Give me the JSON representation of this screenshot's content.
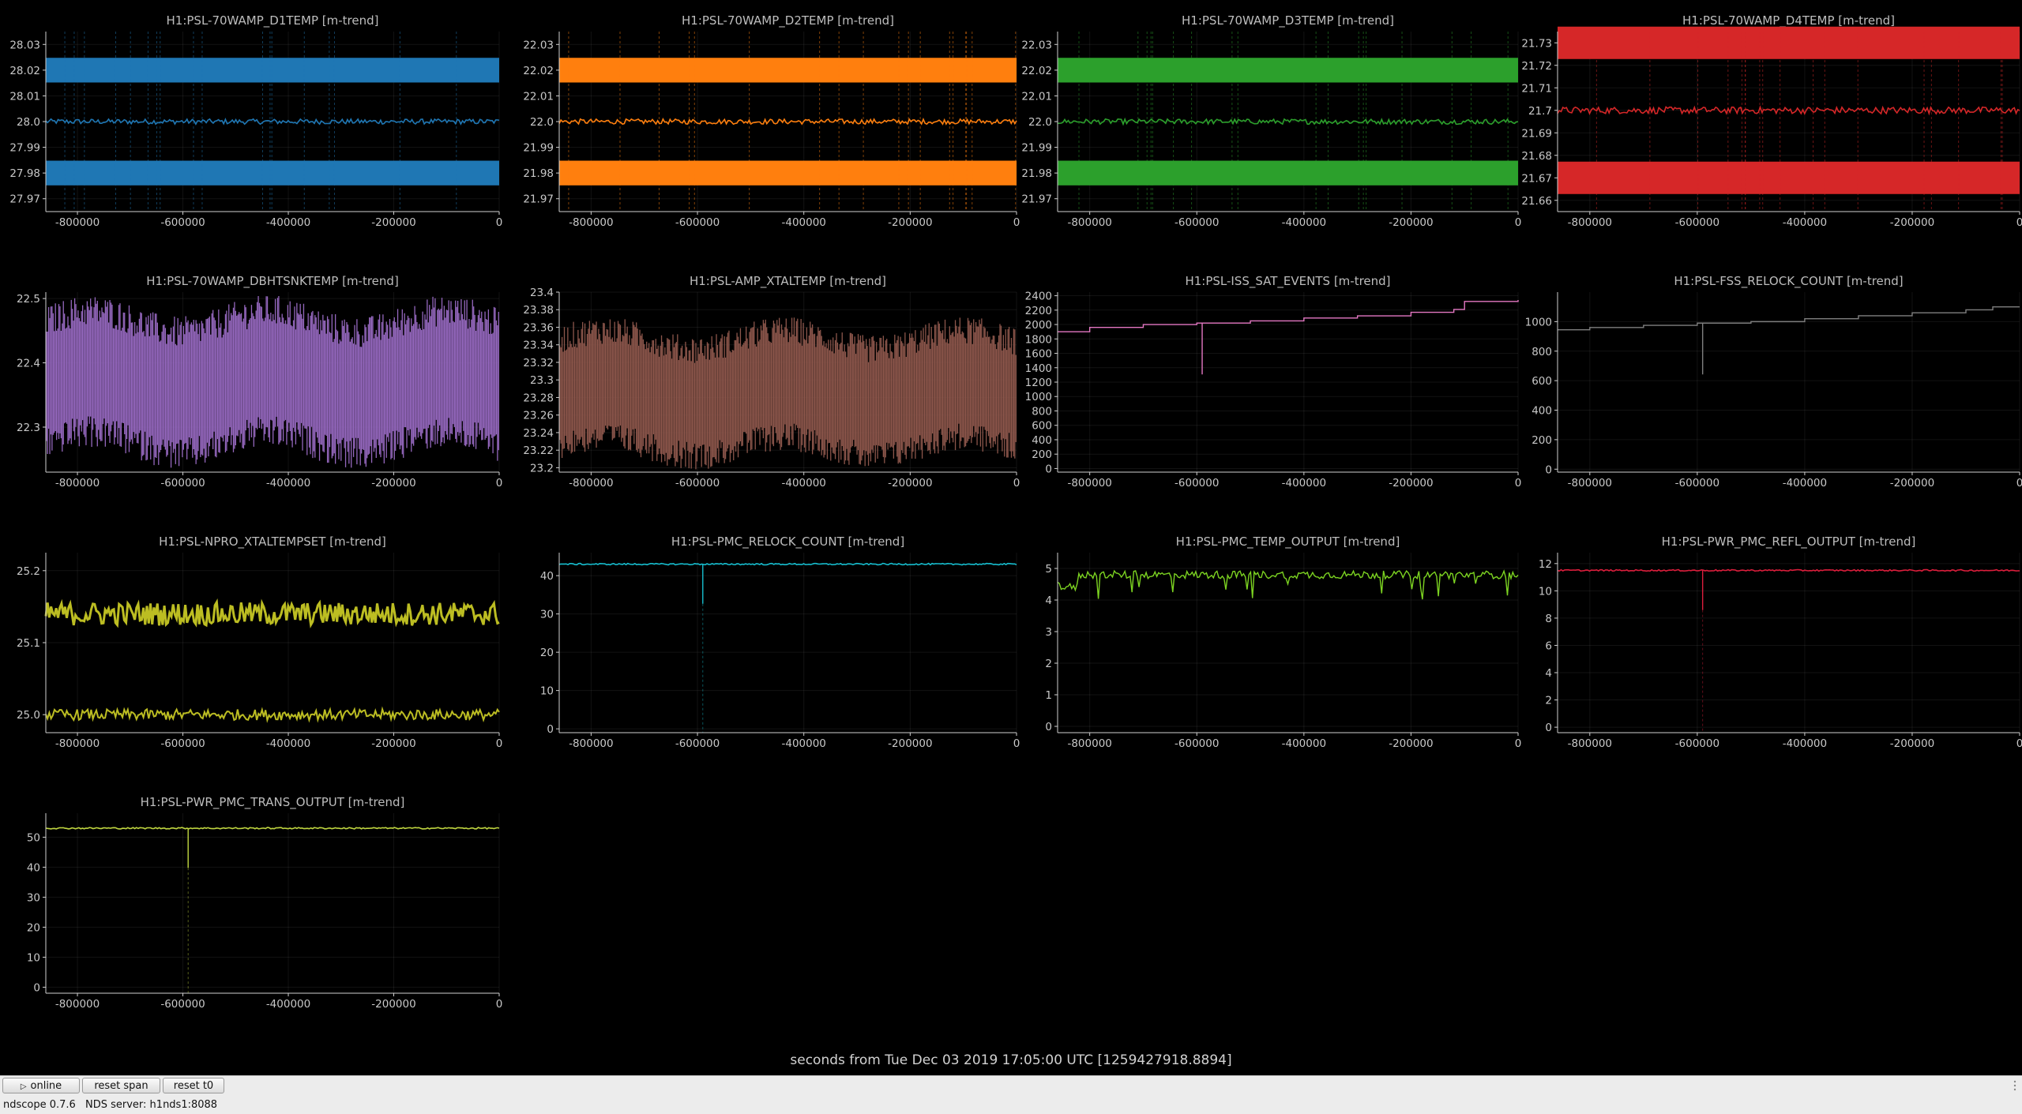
{
  "app": {
    "name": "ndscope",
    "version": "ndscope 0.7.6",
    "nds_server": "NDS server: h1nds1:8088"
  },
  "toolbar": {
    "online_label": "online",
    "reset_span_label": "reset span",
    "reset_t0_label": "reset t0"
  },
  "x_axis_caption": "seconds from Tue Dec 03 2019 17:05:00 UTC [1259427918.8894]",
  "colors": {
    "background": "#000000",
    "toolbar_bg": "#ececec",
    "series": [
      "#1f77b4",
      "#ff7f0e",
      "#2ca02c",
      "#d62728",
      "#9467bd",
      "#8c564b",
      "#e377c2",
      "#7f7f7f",
      "#bcbd22",
      "#17becf",
      "#7cd321",
      "#dc1e3c",
      "#c0d640"
    ]
  },
  "chart_data": [
    {
      "title": "H1:PSL-70WAMP_D1TEMP [m-trend]",
      "type": "line",
      "color": "#1f77b4",
      "xlim": [
        -860000,
        0
      ],
      "ylim": [
        27.965,
        28.035
      ],
      "xticks": [
        -800000,
        -600000,
        -400000,
        -200000,
        0
      ],
      "yticks": [
        27.97,
        27.98,
        27.99,
        28.0,
        28.01,
        28.02,
        28.03
      ],
      "series": [
        {
          "style": "minmax-band",
          "min": 27.98,
          "max": 28.02,
          "mean": 28.0
        }
      ]
    },
    {
      "title": "H1:PSL-70WAMP_D2TEMP [m-trend]",
      "type": "line",
      "color": "#ff7f0e",
      "xlim": [
        -860000,
        0
      ],
      "ylim": [
        21.965,
        22.035
      ],
      "xticks": [
        -800000,
        -600000,
        -400000,
        -200000,
        0
      ],
      "yticks": [
        21.97,
        21.98,
        21.99,
        22.0,
        22.01,
        22.02,
        22.03
      ],
      "series": [
        {
          "style": "minmax-band",
          "min": 21.98,
          "max": 22.02,
          "mean": 22.0
        }
      ]
    },
    {
      "title": "H1:PSL-70WAMP_D3TEMP [m-trend]",
      "type": "line",
      "color": "#2ca02c",
      "xlim": [
        -860000,
        0
      ],
      "ylim": [
        21.965,
        22.035
      ],
      "xticks": [
        -800000,
        -600000,
        -400000,
        -200000,
        0
      ],
      "yticks": [
        21.97,
        21.98,
        21.99,
        22.0,
        22.01,
        22.02,
        22.03
      ],
      "series": [
        {
          "style": "minmax-band",
          "min": 21.98,
          "max": 22.02,
          "mean": 22.0
        }
      ]
    },
    {
      "title": "H1:PSL-70WAMP_D4TEMP [m-trend]",
      "type": "line",
      "color": "#d62728",
      "xlim": [
        -860000,
        0
      ],
      "ylim": [
        21.655,
        21.735
      ],
      "xticks": [
        -800000,
        -600000,
        -400000,
        -200000,
        0
      ],
      "yticks": [
        21.66,
        21.67,
        21.68,
        21.69,
        21.7,
        21.71,
        21.72,
        21.73
      ],
      "series": [
        {
          "style": "minmax-band",
          "min": 21.67,
          "max": 21.73,
          "mean": 21.7
        }
      ]
    },
    {
      "title": "H1:PSL-70WAMP_DBHTSNKTEMP [m-trend]",
      "type": "line",
      "color": "#9467bd",
      "xlim": [
        -860000,
        0
      ],
      "ylim": [
        22.23,
        22.51
      ],
      "xticks": [
        -800000,
        -600000,
        -400000,
        -200000,
        0
      ],
      "yticks": [
        22.3,
        22.4,
        22.5
      ],
      "series": [
        {
          "style": "noisy-band",
          "min": 22.3,
          "max": 22.44,
          "mean": 22.37
        }
      ]
    },
    {
      "title": "H1:PSL-AMP_XTALTEMP [m-trend]",
      "type": "line",
      "color": "#8c564b",
      "xlim": [
        -860000,
        0
      ],
      "ylim": [
        23.195,
        23.4
      ],
      "xticks": [
        -800000,
        -600000,
        -400000,
        -200000,
        0
      ],
      "yticks": [
        23.2,
        23.22,
        23.24,
        23.26,
        23.28,
        23.3,
        23.32,
        23.34,
        23.36,
        23.38,
        23.4
      ],
      "series": [
        {
          "style": "noisy-band",
          "min": 23.24,
          "max": 23.33,
          "mean": 23.29
        }
      ]
    },
    {
      "title": "H1:PSL-ISS_SAT_EVENTS [m-trend]",
      "type": "line",
      "color": "#e377c2",
      "xlim": [
        -860000,
        0
      ],
      "ylim": [
        -50,
        2450
      ],
      "xticks": [
        -800000,
        -600000,
        -400000,
        -200000,
        0
      ],
      "yticks": [
        0,
        200,
        400,
        600,
        800,
        1000,
        1200,
        1400,
        1600,
        1800,
        2000,
        2200,
        2400
      ],
      "series": [
        {
          "style": "step",
          "x": [
            -860000,
            -800000,
            -700000,
            -600000,
            -500000,
            -400000,
            -300000,
            -200000,
            -120000,
            -100000,
            0
          ],
          "y": [
            1900,
            1960,
            2000,
            2020,
            2050,
            2090,
            2120,
            2170,
            2210,
            2320,
            2340
          ]
        }
      ]
    },
    {
      "title": "H1:PSL-FSS_RELOCK_COUNT [m-trend]",
      "type": "line",
      "color": "#7f7f7f",
      "xlim": [
        -860000,
        0
      ],
      "ylim": [
        -20,
        1200
      ],
      "xticks": [
        -800000,
        -600000,
        -400000,
        -200000,
        0
      ],
      "yticks": [
        0,
        200,
        400,
        600,
        800,
        1000
      ],
      "series": [
        {
          "style": "step",
          "x": [
            -860000,
            -800000,
            -700000,
            -600000,
            -500000,
            -400000,
            -300000,
            -200000,
            -100000,
            -50000,
            0
          ],
          "y": [
            945,
            960,
            975,
            990,
            1000,
            1020,
            1040,
            1060,
            1080,
            1100,
            1100
          ]
        }
      ]
    },
    {
      "title": "H1:PSL-NPRO_XTALTEMPSET [m-trend]",
      "type": "line",
      "color": "#bcbd22",
      "xlim": [
        -860000,
        0
      ],
      "ylim": [
        24.975,
        25.225
      ],
      "xticks": [
        -800000,
        -600000,
        -400000,
        -200000,
        0
      ],
      "yticks": [
        25.0,
        25.1,
        25.2
      ],
      "series": [
        {
          "style": "two-level",
          "levels": [
            25.0,
            25.14
          ]
        }
      ]
    },
    {
      "title": "H1:PSL-PMC_RELOCK_COUNT [m-trend]",
      "type": "line",
      "color": "#17becf",
      "xlim": [
        -860000,
        0
      ],
      "ylim": [
        -1,
        46
      ],
      "xticks": [
        -800000,
        -600000,
        -400000,
        -200000,
        0
      ],
      "yticks": [
        0,
        10,
        20,
        30,
        40
      ],
      "series": [
        {
          "style": "flat",
          "value": 43
        }
      ]
    },
    {
      "title": "H1:PSL-PMC_TEMP_OUTPUT [m-trend]",
      "type": "line",
      "color": "#7cd321",
      "xlim": [
        -860000,
        0
      ],
      "ylim": [
        -0.2,
        5.5
      ],
      "xticks": [
        -800000,
        -600000,
        -400000,
        -200000,
        0
      ],
      "yticks": [
        0,
        1,
        2,
        3,
        4,
        5
      ],
      "series": [
        {
          "style": "noisy-line",
          "mean": 4.8,
          "min": 4.0,
          "max": 5.1
        }
      ]
    },
    {
      "title": "H1:PSL-PWR_PMC_REFL_OUTPUT [m-trend]",
      "type": "line",
      "color": "#dc1e3c",
      "xlim": [
        -860000,
        0
      ],
      "ylim": [
        -0.4,
        12.8
      ],
      "xticks": [
        -800000,
        -600000,
        -400000,
        -200000,
        0
      ],
      "yticks": [
        0,
        2,
        4,
        6,
        8,
        10,
        12
      ],
      "series": [
        {
          "style": "flat",
          "value": 11.5
        }
      ]
    },
    {
      "title": "H1:PSL-PWR_PMC_TRANS_OUTPUT [m-trend]",
      "type": "line",
      "color": "#c0d640",
      "xlim": [
        -860000,
        0
      ],
      "ylim": [
        -2,
        58
      ],
      "xticks": [
        -800000,
        -600000,
        -400000,
        -200000,
        0
      ],
      "yticks": [
        0,
        10,
        20,
        30,
        40,
        50
      ],
      "series": [
        {
          "style": "flat",
          "value": 53
        }
      ]
    }
  ]
}
